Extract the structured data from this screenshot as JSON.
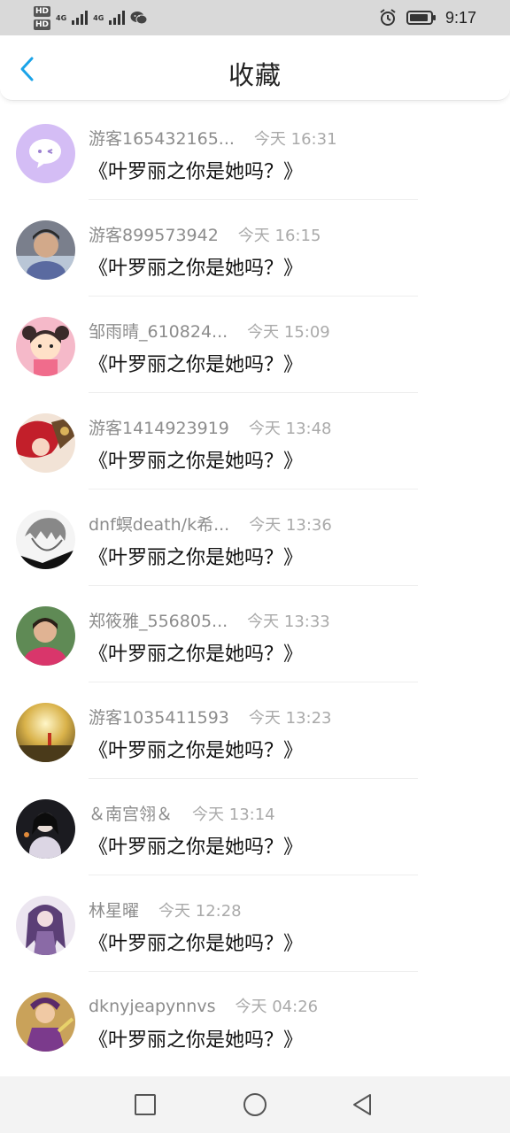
{
  "status_bar": {
    "hd1": "HD",
    "hd2": "HD",
    "net1": "4G",
    "net2": "4G",
    "time": "9:17",
    "icons": [
      "signal-icon",
      "wechat-icon",
      "alarm-icon",
      "battery-icon"
    ]
  },
  "header": {
    "title": "收藏",
    "back_icon": "chevron-left-icon"
  },
  "favorites": [
    {
      "user": "游客165432165...",
      "time": "今天 16:31",
      "title": "《叶罗丽之你是她吗？》",
      "avatar": "chat-bubble-avatar"
    },
    {
      "user": "游客899573942",
      "time": "今天 16:15",
      "title": "《叶罗丽之你是她吗？》",
      "avatar": "photo-avatar"
    },
    {
      "user": "邹雨晴_610824...",
      "time": "今天 15:09",
      "title": "《叶罗丽之你是她吗？》",
      "avatar": "cartoon-girl-avatar"
    },
    {
      "user": "游客1414923919",
      "time": "今天 13:48",
      "title": "《叶罗丽之你是她吗？》",
      "avatar": "anime-red-hair-avatar"
    },
    {
      "user": "dnf螟death/k希...",
      "time": "今天 13:36",
      "title": "《叶罗丽之你是她吗？》",
      "avatar": "anime-sketch-avatar"
    },
    {
      "user": "郑筱雅_556805...",
      "time": "今天 13:33",
      "title": "《叶罗丽之你是她吗？》",
      "avatar": "girl-photo-avatar"
    },
    {
      "user": "游客1035411593",
      "time": "今天 13:23",
      "title": "《叶罗丽之你是她吗？》",
      "avatar": "sunset-avatar"
    },
    {
      "user": "＆南宫翎＆",
      "time": "今天 13:14",
      "title": "《叶罗丽之你是她吗？》",
      "avatar": "dark-portrait-avatar"
    },
    {
      "user": "林星曜",
      "time": "今天 12:28",
      "title": "《叶罗丽之你是她吗？》",
      "avatar": "anime-purple-avatar"
    },
    {
      "user": "dknyjeapynnvs",
      "time": "今天 04:26",
      "title": "《叶罗丽之你是她吗？》",
      "avatar": "game-character-avatar"
    }
  ],
  "bottom_nav": {
    "icons": [
      "recent-apps-icon",
      "home-icon",
      "back-icon"
    ]
  },
  "colors": {
    "accent": "#1aa3e8",
    "status_bar_bg": "#d9d9d9",
    "username": "#8c8c8c",
    "timestamp": "#aaaaaa",
    "title_text": "#111111",
    "bottom_nav_bg": "#f3f3f3"
  }
}
